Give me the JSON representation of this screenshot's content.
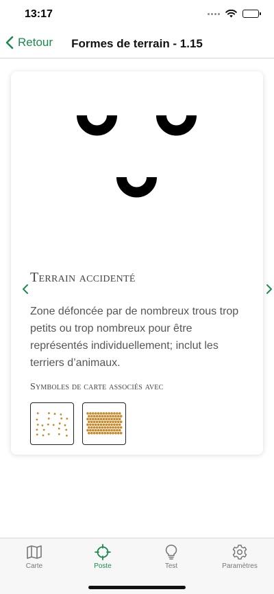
{
  "status_bar": {
    "time": "13:17"
  },
  "nav": {
    "back_label": "Retour",
    "title": "Formes de terrain - 1.15"
  },
  "card": {
    "title": "Terrain accidenté",
    "description": "Zone défoncée par de nombreux trous trop petits ou trop nombreux pour être représentés individuellement; inclut les terriers d’animaux.",
    "associated_label": "Symboles de carte associés avec"
  },
  "tabs": [
    {
      "label": "Carte",
      "icon": "map-icon"
    },
    {
      "label": "Poste",
      "icon": "crosshair-icon",
      "active": true
    },
    {
      "label": "Test",
      "icon": "lightbulb-icon"
    },
    {
      "label": "Paramètres",
      "icon": "gear-icon"
    }
  ],
  "colors": {
    "accent": "#1b8a4c",
    "symbol_dots": "#c8882a"
  }
}
